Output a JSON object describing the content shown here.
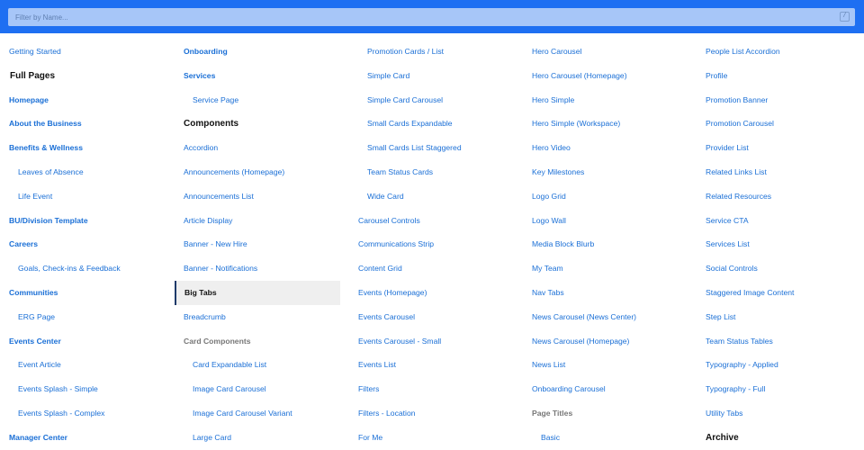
{
  "filter": {
    "placeholder": "Filter by Name...",
    "shortcut": "/"
  },
  "columns": [
    [
      {
        "label": "Getting Started",
        "kind": "plain"
      },
      {
        "label": "Full Pages",
        "kind": "heading"
      },
      {
        "label": "Homepage",
        "kind": "top"
      },
      {
        "label": "About the Business",
        "kind": "top"
      },
      {
        "label": "Benefits & Wellness",
        "kind": "top"
      },
      {
        "label": "Leaves of Absence",
        "kind": "sub"
      },
      {
        "label": "Life Event",
        "kind": "sub"
      },
      {
        "label": "BU/Division Template",
        "kind": "top"
      },
      {
        "label": "Careers",
        "kind": "top"
      },
      {
        "label": "Goals, Check-ins & Feedback",
        "kind": "sub"
      },
      {
        "label": "Communities",
        "kind": "top"
      },
      {
        "label": "ERG Page",
        "kind": "sub"
      },
      {
        "label": "Events Center",
        "kind": "top"
      },
      {
        "label": "Event Article",
        "kind": "sub"
      },
      {
        "label": "Events Splash - Simple",
        "kind": "sub"
      },
      {
        "label": "Events Splash - Complex",
        "kind": "sub"
      },
      {
        "label": "Manager Center",
        "kind": "top"
      }
    ],
    [
      {
        "label": "Onboarding",
        "kind": "top"
      },
      {
        "label": "Services",
        "kind": "top"
      },
      {
        "label": "Service Page",
        "kind": "sub"
      },
      {
        "label": "Components",
        "kind": "heading"
      },
      {
        "label": "Accordion",
        "kind": "plain"
      },
      {
        "label": "Announcements (Homepage)",
        "kind": "plain"
      },
      {
        "label": "Announcements List",
        "kind": "plain"
      },
      {
        "label": "Article Display",
        "kind": "plain"
      },
      {
        "label": "Banner - New Hire",
        "kind": "plain"
      },
      {
        "label": "Banner - Notifications",
        "kind": "plain"
      },
      {
        "label": "Big Tabs",
        "kind": "active"
      },
      {
        "label": "Breadcrumb",
        "kind": "plain"
      },
      {
        "label": "Card Components",
        "kind": "group"
      },
      {
        "label": "Card Expandable List",
        "kind": "sub"
      },
      {
        "label": "Image Card Carousel",
        "kind": "sub"
      },
      {
        "label": "Image Card Carousel Variant",
        "kind": "sub"
      },
      {
        "label": "Large Card",
        "kind": "sub"
      }
    ],
    [
      {
        "label": "Promotion Cards / List",
        "kind": "sub"
      },
      {
        "label": "Simple Card",
        "kind": "sub"
      },
      {
        "label": "Simple Card Carousel",
        "kind": "sub"
      },
      {
        "label": "Small Cards Expandable",
        "kind": "sub"
      },
      {
        "label": "Small Cards List Staggered",
        "kind": "sub"
      },
      {
        "label": "Team Status Cards",
        "kind": "sub"
      },
      {
        "label": "Wide Card",
        "kind": "sub"
      },
      {
        "label": "Carousel Controls",
        "kind": "plain"
      },
      {
        "label": "Communications Strip",
        "kind": "plain"
      },
      {
        "label": "Content Grid",
        "kind": "plain"
      },
      {
        "label": "Events (Homepage)",
        "kind": "plain"
      },
      {
        "label": "Events Carousel",
        "kind": "plain"
      },
      {
        "label": "Events Carousel - Small",
        "kind": "plain"
      },
      {
        "label": "Events List",
        "kind": "plain"
      },
      {
        "label": "Filters",
        "kind": "plain"
      },
      {
        "label": "Filters - Location",
        "kind": "plain"
      },
      {
        "label": "For Me",
        "kind": "plain"
      }
    ],
    [
      {
        "label": "Hero Carousel",
        "kind": "plain"
      },
      {
        "label": "Hero Carousel (Homepage)",
        "kind": "plain"
      },
      {
        "label": "Hero Simple",
        "kind": "plain"
      },
      {
        "label": "Hero Simple (Workspace)",
        "kind": "plain"
      },
      {
        "label": "Hero Video",
        "kind": "plain"
      },
      {
        "label": "Key Milestones",
        "kind": "plain"
      },
      {
        "label": "Logo Grid",
        "kind": "plain"
      },
      {
        "label": "Logo Wall",
        "kind": "plain"
      },
      {
        "label": "Media Block Blurb",
        "kind": "plain"
      },
      {
        "label": "My Team",
        "kind": "plain"
      },
      {
        "label": "Nav Tabs",
        "kind": "plain"
      },
      {
        "label": "News Carousel (News Center)",
        "kind": "plain"
      },
      {
        "label": "News Carousel (Homepage)",
        "kind": "plain"
      },
      {
        "label": "News List",
        "kind": "plain"
      },
      {
        "label": "Onboarding Carousel",
        "kind": "plain"
      },
      {
        "label": "Page Titles",
        "kind": "group"
      },
      {
        "label": "Basic",
        "kind": "sub"
      }
    ],
    [
      {
        "label": "People List Accordion",
        "kind": "plain"
      },
      {
        "label": "Profile",
        "kind": "plain"
      },
      {
        "label": "Promotion Banner",
        "kind": "plain"
      },
      {
        "label": "Promotion Carousel",
        "kind": "plain"
      },
      {
        "label": "Provider List",
        "kind": "plain"
      },
      {
        "label": "Related Links List",
        "kind": "plain"
      },
      {
        "label": "Related Resources",
        "kind": "plain"
      },
      {
        "label": "Service CTA",
        "kind": "plain"
      },
      {
        "label": "Services List",
        "kind": "plain"
      },
      {
        "label": "Social Controls",
        "kind": "plain"
      },
      {
        "label": "Staggered Image Content",
        "kind": "plain"
      },
      {
        "label": "Step List",
        "kind": "plain"
      },
      {
        "label": "Team Status Tables",
        "kind": "plain"
      },
      {
        "label": "Typography - Applied",
        "kind": "plain"
      },
      {
        "label": "Typography - Full",
        "kind": "plain"
      },
      {
        "label": "Utility Tabs",
        "kind": "plain"
      },
      {
        "label": "Archive",
        "kind": "heading"
      }
    ]
  ]
}
